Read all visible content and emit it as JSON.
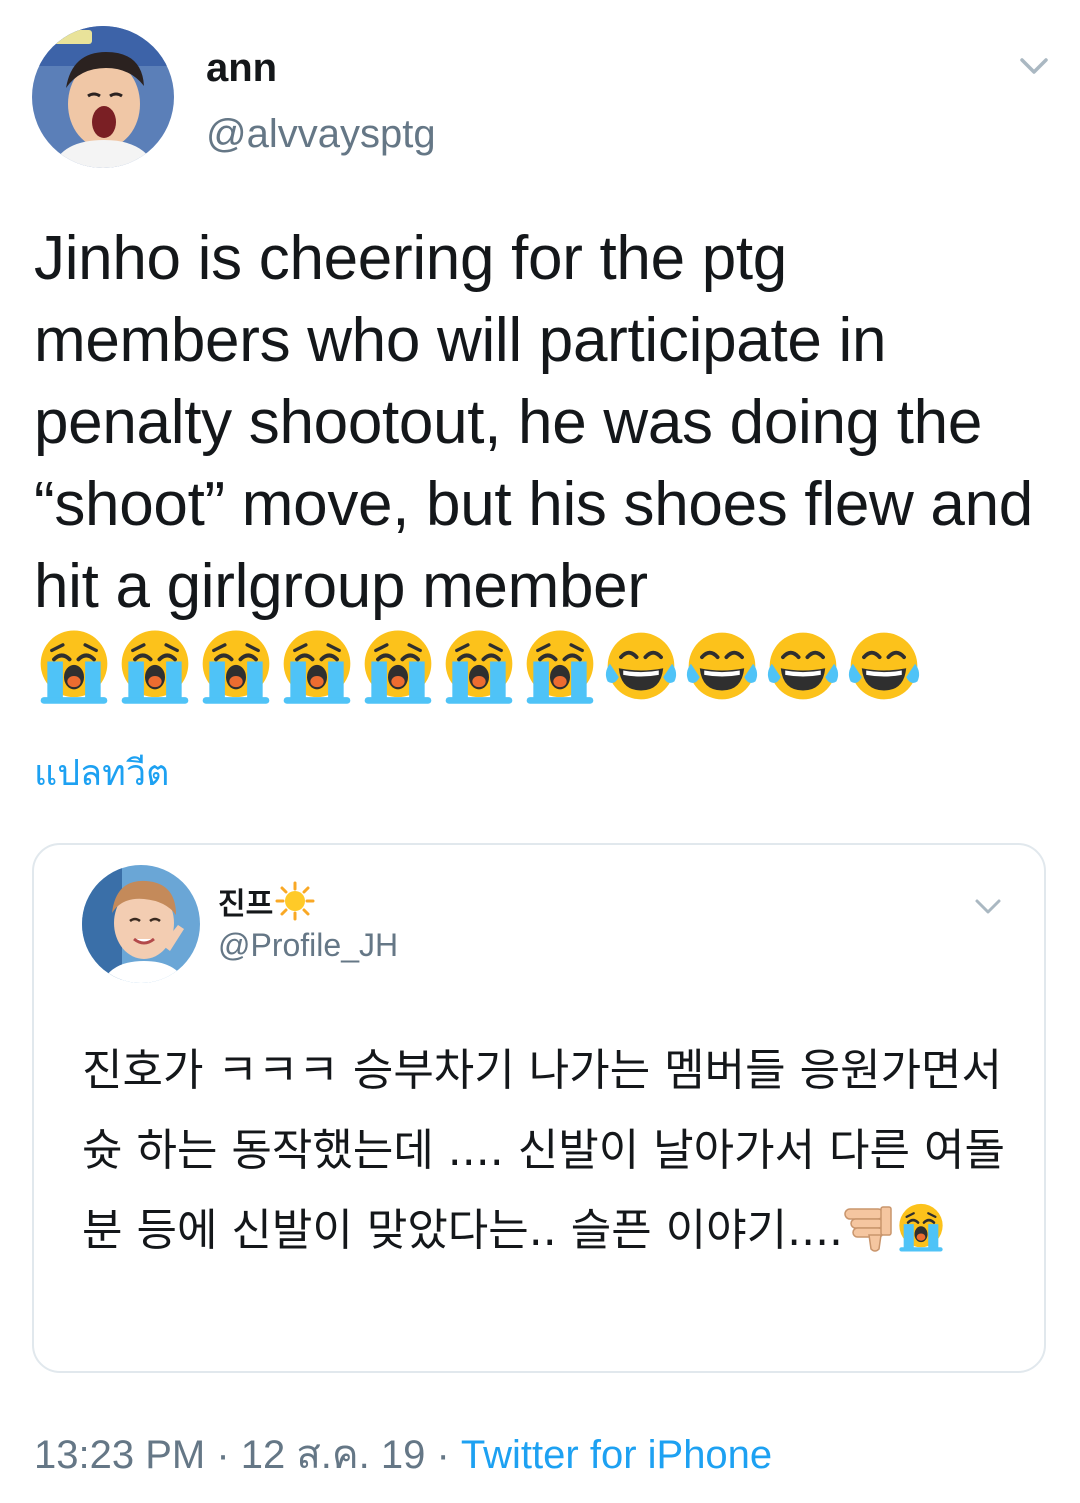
{
  "tweet": {
    "author_name": "ann",
    "author_handle": "@alvvaysptg",
    "text": "Jinho is cheering for the ptg members who will participate in penalty shootout, he was doing the “shoot” move, but his shoes flew and hit a girlgroup member",
    "emoji": [
      "loudly-crying-face",
      "loudly-crying-face",
      "loudly-crying-face",
      "loudly-crying-face",
      "loudly-crying-face",
      "loudly-crying-face",
      "loudly-crying-face",
      "face-with-tears-of-joy",
      "face-with-tears-of-joy",
      "face-with-tears-of-joy",
      "face-with-tears-of-joy"
    ],
    "translate_label": "แปลทวีต",
    "time": "13:23 PM",
    "separator": " · ",
    "date": "12 ส.ค. 19",
    "source": "Twitter for iPhone"
  },
  "quoted_tweet": {
    "author_name": "진프",
    "name_emoji": "sun-icon",
    "author_handle": "@Profile_JH",
    "text": "진호가 ㅋㅋㅋ 승부차기 나가는 멤버들 응원가면서 슛 하는 동작했는데 .... 신발이 날아가서 다른 여돌 분 등에 신발이 맞았다는.. 슬픈 이야기....",
    "trailing_emoji": [
      "thumbs-down-icon",
      "loudly-crying-face"
    ]
  },
  "colors": {
    "text": "#14171a",
    "secondary": "#657786",
    "accent": "#1da1f2",
    "border": "#e1e8ed"
  }
}
